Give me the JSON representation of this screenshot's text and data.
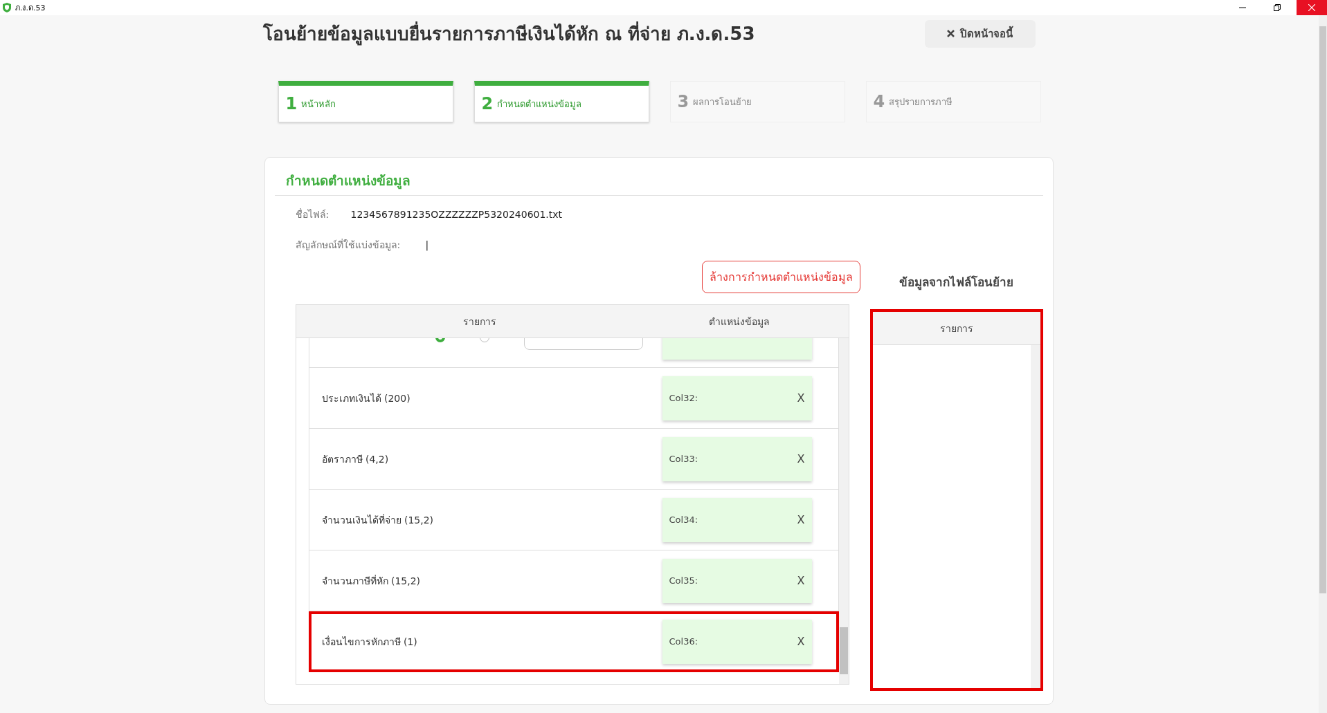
{
  "window": {
    "title": "ภ.ง.ด.53"
  },
  "page": {
    "title": "โอนย้ายข้อมูลแบบยื่นรายการภาษีเงินได้หัก ณ ที่จ่าย ภ.ง.ด.53",
    "close_button": "ปิดหน้าจอนี้"
  },
  "steps": [
    {
      "number": "1",
      "label": "หน้าหลัก",
      "done": true
    },
    {
      "number": "2",
      "label": "กำหนดตำแหน่งข้อมูล",
      "done": true
    },
    {
      "number": "3",
      "label": "ผลการโอนย้าย",
      "done": false
    },
    {
      "number": "4",
      "label": "สรุปรายการภาษี",
      "done": false
    }
  ],
  "section": {
    "title": "กำหนดตำแหน่งข้อมูล",
    "file_label": "ชื่อไฟล์:",
    "file_name": "1234567891235OZZZZZZP5320240601.txt",
    "separator_label": "สัญลักษณ์ที่ใช้แบ่งข้อมูล:",
    "separator_value": "|",
    "clear_button": "ล้างการกำหนดตำแหน่งข้อมูล"
  },
  "mapping_table": {
    "columns": [
      "รายการ",
      "ตำแหน่งข้อมูล"
    ],
    "rows": [
      {
        "kind": "date",
        "options": [
          {
            "selected": true
          },
          {
            "selected": false
          }
        ],
        "highlighted": false
      },
      {
        "kind": "plain",
        "label": "ประเภทเงินได้ (200)",
        "column": "Col32:",
        "remove": "X",
        "highlighted": false
      },
      {
        "kind": "plain",
        "label": "อัตราภาษี (4,2)",
        "column": "Col33:",
        "remove": "X",
        "highlighted": false
      },
      {
        "kind": "plain",
        "label": "จำนวนเงินได้ที่จ่าย (15,2)",
        "column": "Col34:",
        "remove": "X",
        "highlighted": false
      },
      {
        "kind": "plain",
        "label": "จำนวนภาษีที่หัก (15,2)",
        "column": "Col35:",
        "remove": "X",
        "highlighted": false
      },
      {
        "kind": "plain",
        "label": "เงื่อนไขการหักภาษี (1)",
        "column": "Col36:",
        "remove": "X",
        "highlighted": true
      }
    ]
  },
  "source_panel": {
    "title": "ข้อมูลจากไฟล์โอนย้าย",
    "column": "รายการ",
    "highlighted": true
  }
}
